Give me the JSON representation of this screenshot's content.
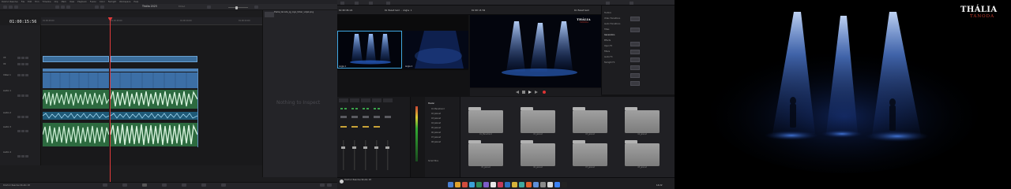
{
  "left_monitor": {
    "menu": [
      "DaVinci Resolve",
      "File",
      "Edit",
      "Trim",
      "Timeline",
      "Clip",
      "Mark",
      "View",
      "Playback",
      "Fusion",
      "Color",
      "Fairlight",
      "Workspace",
      "Help"
    ],
    "project_title": "Thália 2023",
    "edited_label": "Edited",
    "timecode": "01:00:15:56",
    "ruler_ticks": [
      "01:00:00:00",
      "01:00:08:00",
      "01:00:16:00",
      "01:00:24:00"
    ],
    "tracks": [
      {
        "name": "V3",
        "type": "title"
      },
      {
        "name": "V2",
        "type": "title"
      },
      {
        "name": "V1",
        "type": "video",
        "label": "Video 1"
      },
      {
        "name": "A1",
        "type": "audio",
        "label": "Audio 1"
      },
      {
        "name": "A2",
        "type": "audio",
        "label": "Audio 2"
      },
      {
        "name": "A3",
        "type": "audio",
        "label": "Audio 3"
      },
      {
        "name": "A4",
        "type": "audio",
        "label": "Audio 4"
      }
    ],
    "viewer_file": "thalia_tanoda_ig_logo_feher_vizjel.png",
    "viewer_empty_text": "Nothing to Inspect",
    "bottom_label": "DaVinci Resolve Studio 18"
  },
  "middle_monitor": {
    "source_tc": "01:00:06:22",
    "source_name": "01 Menetrend - Angle 1",
    "program_tc": "01:00:15:56",
    "program_name": "01 Menetrend",
    "angles": [
      "Angle 1",
      "Angle 2"
    ],
    "inspector_items": [
      "Toolbox",
      "Video Transitions",
      "Audio Transitions",
      "Titles",
      "Generators",
      "Effects",
      "Open FX",
      "Filters",
      "Audio FX",
      "Fairlight FX"
    ],
    "bins": [
      "Master",
      "01 Menetrend",
      "02 Jelenet",
      "03 Jelenet",
      "04 Jelenet",
      "05 Jelenet",
      "06 Jelenet",
      "07 Jelenet",
      "08 Jelenet"
    ],
    "smart_bins": "Smart Bins",
    "folders": [
      "01_Menetrend",
      "02_Jelenet",
      "03_Jelenet",
      "04_Jelenet",
      "05_Jelenet",
      "06_Jelenet",
      "07_Jelenet",
      "08_Jelenet"
    ],
    "app_label": "DaVinci Resolve Studio 18",
    "clock": "14:22"
  },
  "right_monitor": {
    "logo_main": "THÁLIA",
    "logo_sub": "TANODA"
  },
  "colors": {
    "playhead": "#e23b3b",
    "title_clip": "#3b6d9b",
    "video_clip": "#3c6fa6",
    "audio_clip": "#2c6a3f",
    "spotlight": "#3a72d8",
    "logo_red": "#c0392b"
  }
}
